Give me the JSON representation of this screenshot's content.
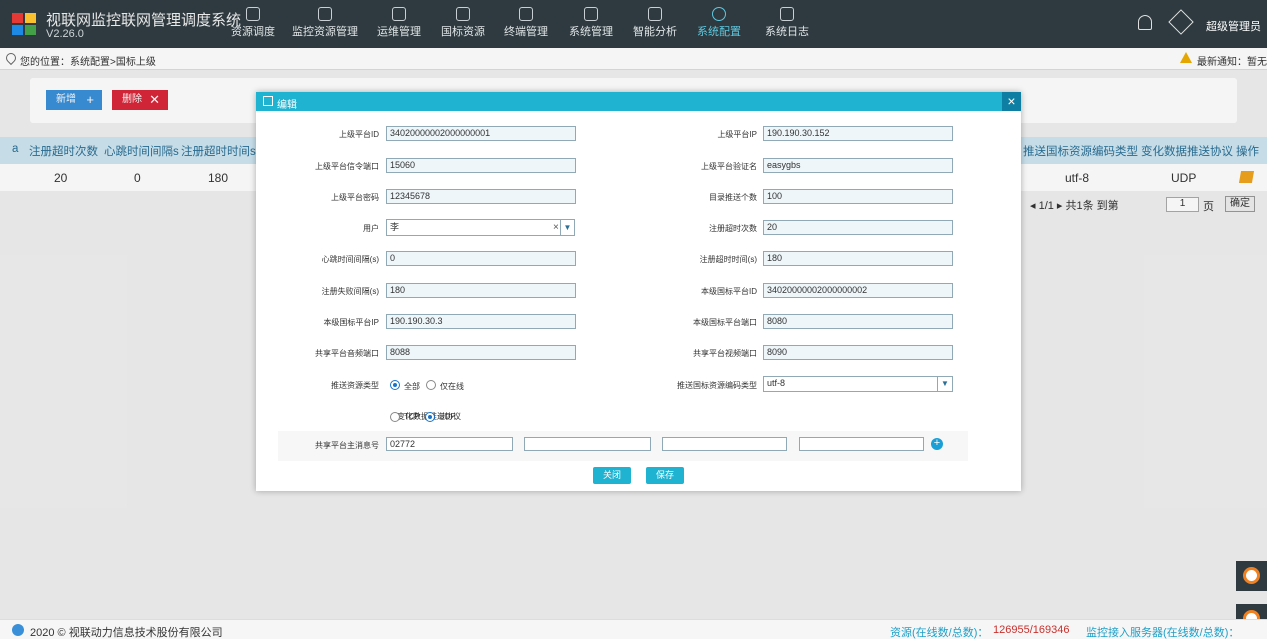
{
  "header": {
    "title": "视联网监控联网管理调度系统",
    "version": "V2.26.0",
    "user": "超级管理员",
    "colors": {
      "bar": "#2e3a3f",
      "active": "#5fc8e0"
    },
    "nav": [
      {
        "label": "资源调度",
        "icon": "compass-icon"
      },
      {
        "label": "监控资源管理",
        "icon": "location-icon"
      },
      {
        "label": "运维管理",
        "icon": "tools-icon"
      },
      {
        "label": "国标资源",
        "icon": "edit-icon"
      },
      {
        "label": "终端管理",
        "icon": "list-icon"
      },
      {
        "label": "系统管理",
        "icon": "grid-icon"
      },
      {
        "label": "智能分析",
        "icon": "scan-icon"
      },
      {
        "label": "系统配置",
        "icon": "gear-icon",
        "active": true
      },
      {
        "label": "系统日志",
        "icon": "calendar-icon"
      }
    ]
  },
  "location": {
    "breadcrumb": "您的位置：系统配置>国标上级",
    "notice": "最新通知：暂无"
  },
  "toolbar": {
    "add_label": "新增",
    "delete_label": "删除"
  },
  "grid": {
    "headers": [
      "a",
      "注册超时次数",
      "心跳时间间隔s",
      "注册超时时间s",
      "推送国标资源编码类型",
      "变化数据推送协议",
      "操作"
    ],
    "row": [
      "20",
      "0",
      "180",
      "utf-8",
      "UDP"
    ],
    "pager": {
      "text": "1/1 ▸ 共1条 到第",
      "page": "1",
      "page_suffix": "页",
      "ok": "确定"
    }
  },
  "modal": {
    "title": "编辑",
    "close": "×",
    "fields": {
      "parent_id": {
        "label": "上级平台ID",
        "value": "34020000002000000001"
      },
      "parent_ip": {
        "label": "上级平台IP",
        "value": "190.190.30.152"
      },
      "signal_port": {
        "label": "上级平台信令端口",
        "value": "15060"
      },
      "auth_name": {
        "label": "上级平台验证名",
        "value": "easygbs"
      },
      "password": {
        "label": "上级平台密码",
        "value": "12345678"
      },
      "push_count": {
        "label": "目录推送个数",
        "value": "100"
      },
      "user": {
        "label": "用户",
        "value": "李"
      },
      "reg_timeout_count": {
        "label": "注册超时次数",
        "value": "20"
      },
      "heartbeat": {
        "label": "心跳时间间隔(s)",
        "value": "0"
      },
      "reg_timeout": {
        "label": "注册超时时间(s)",
        "value": "180"
      },
      "reg_fail_interval": {
        "label": "注册失败间隔(s)",
        "value": "180"
      },
      "local_id": {
        "label": "本级国标平台ID",
        "value": "34020000002000000002"
      },
      "local_ip": {
        "label": "本级国标平台IP",
        "value": "190.190.30.3"
      },
      "local_port": {
        "label": "本级国标平台端口",
        "value": "8080"
      },
      "audio_port": {
        "label": "共享平台音频端口",
        "value": "8088"
      },
      "video_port": {
        "label": "共享平台视频端口",
        "value": "8090"
      },
      "push_type": {
        "label": "推送资源类型",
        "options": [
          "全部",
          "仅在线"
        ]
      },
      "encoding": {
        "label": "推送国标资源编码类型",
        "value": "utf-8"
      },
      "protocol": {
        "label": "变化数据推送协议",
        "options": [
          "TCP",
          "UDP"
        ]
      },
      "subid": {
        "label": "共享平台主消息号",
        "value": "02772"
      }
    },
    "buttons": {
      "close": "关闭",
      "save": "保存"
    }
  },
  "footer": {
    "copyright": "2020 © 视联动力信息技术股份有限公司",
    "res_label": "资源(在线数/总数)：",
    "res_value": "126955/169346",
    "server_label": "监控接入服务器(在线数/总数)："
  }
}
